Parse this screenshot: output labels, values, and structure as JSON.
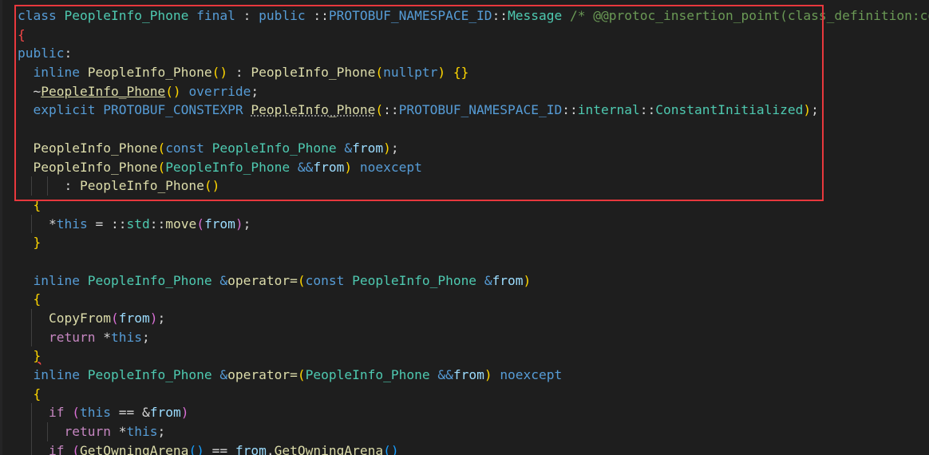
{
  "editor": {
    "theme_colors": {
      "background": "#1e1e1e",
      "keyword": "#569cd6",
      "control_keyword": "#c586c0",
      "type": "#4ec9b0",
      "function": "#dcdcaa",
      "variable": "#9cdcfe",
      "comment": "#6a9955",
      "highlight_border": "#e8383d"
    },
    "lines": [
      {
        "indent": 0,
        "guides": 0,
        "tokens": [
          {
            "t": "class ",
            "c": "kw"
          },
          {
            "t": "PeopleInfo_Phone",
            "c": "ty"
          },
          {
            "t": " ",
            "c": "p"
          },
          {
            "t": "final",
            "c": "kw"
          },
          {
            "t": " : ",
            "c": "p"
          },
          {
            "t": "public",
            "c": "kw"
          },
          {
            "t": " ::",
            "c": "p"
          },
          {
            "t": "PROTOBUF_NAMESPACE_ID",
            "c": "mac"
          },
          {
            "t": "::",
            "c": "p"
          },
          {
            "t": "Message",
            "c": "ty"
          },
          {
            "t": " /* @@protoc_insertion_point(class_definition:com",
            "c": "cm"
          }
        ]
      },
      {
        "indent": 0,
        "guides": 0,
        "tokens": [
          {
            "t": "{",
            "c": "err"
          }
        ]
      },
      {
        "indent": 0,
        "guides": 0,
        "tokens": [
          {
            "t": "public",
            "c": "kw"
          },
          {
            "t": ":",
            "c": "p"
          }
        ]
      },
      {
        "indent": 2,
        "guides": 0,
        "tokens": [
          {
            "t": "inline",
            "c": "kw"
          },
          {
            "t": " ",
            "c": "p"
          },
          {
            "t": "PeopleInfo_Phone",
            "c": "fn"
          },
          {
            "t": "()",
            "c": "br1"
          },
          {
            "t": " : ",
            "c": "p"
          },
          {
            "t": "PeopleInfo_Phone",
            "c": "fn"
          },
          {
            "t": "(",
            "c": "br1"
          },
          {
            "t": "nullptr",
            "c": "kw"
          },
          {
            "t": ")",
            "c": "br1"
          },
          {
            "t": " ",
            "c": "p"
          },
          {
            "t": "{}",
            "c": "br1"
          }
        ]
      },
      {
        "indent": 2,
        "guides": 0,
        "tokens": [
          {
            "t": "~",
            "c": "p"
          },
          {
            "t": "PeopleInfo_Phone",
            "c": "fn ul"
          },
          {
            "t": "()",
            "c": "br1"
          },
          {
            "t": " ",
            "c": "p"
          },
          {
            "t": "override",
            "c": "kw"
          },
          {
            "t": ";",
            "c": "p"
          }
        ]
      },
      {
        "indent": 2,
        "guides": 0,
        "tokens": [
          {
            "t": "explicit",
            "c": "kw"
          },
          {
            "t": " ",
            "c": "p"
          },
          {
            "t": "PROTOBUF_CONSTEXPR",
            "c": "mac"
          },
          {
            "t": " ",
            "c": "p"
          },
          {
            "t": "PeopleInfo_Phone",
            "c": "fn dots"
          },
          {
            "t": "(",
            "c": "br1"
          },
          {
            "t": "::",
            "c": "p"
          },
          {
            "t": "PROTOBUF_NAMESPACE_ID",
            "c": "mac"
          },
          {
            "t": "::",
            "c": "p"
          },
          {
            "t": "internal",
            "c": "ty"
          },
          {
            "t": "::",
            "c": "p"
          },
          {
            "t": "ConstantInitialized",
            "c": "ty"
          },
          {
            "t": ")",
            "c": "br1"
          },
          {
            "t": ";",
            "c": "p"
          }
        ]
      },
      {
        "indent": 0,
        "guides": 0,
        "tokens": []
      },
      {
        "indent": 2,
        "guides": 0,
        "tokens": [
          {
            "t": "PeopleInfo_Phone",
            "c": "fn"
          },
          {
            "t": "(",
            "c": "br1"
          },
          {
            "t": "const",
            "c": "kw"
          },
          {
            "t": " ",
            "c": "p"
          },
          {
            "t": "PeopleInfo_Phone",
            "c": "ty"
          },
          {
            "t": " ",
            "c": "p"
          },
          {
            "t": "&",
            "c": "kw"
          },
          {
            "t": "from",
            "c": "var"
          },
          {
            "t": ")",
            "c": "br1"
          },
          {
            "t": ";",
            "c": "p"
          }
        ]
      },
      {
        "indent": 2,
        "guides": 0,
        "tokens": [
          {
            "t": "PeopleInfo_Phone",
            "c": "fn"
          },
          {
            "t": "(",
            "c": "br1"
          },
          {
            "t": "PeopleInfo_Phone",
            "c": "ty"
          },
          {
            "t": " ",
            "c": "p"
          },
          {
            "t": "&&",
            "c": "kw"
          },
          {
            "t": "from",
            "c": "var"
          },
          {
            "t": ")",
            "c": "br1"
          },
          {
            "t": " ",
            "c": "p"
          },
          {
            "t": "noexcept",
            "c": "kw"
          }
        ]
      },
      {
        "indent": 6,
        "guides": 2,
        "tokens": [
          {
            "t": ": ",
            "c": "p"
          },
          {
            "t": "PeopleInfo_Phone",
            "c": "fn"
          },
          {
            "t": "()",
            "c": "br1"
          }
        ]
      },
      {
        "indent": 2,
        "guides": 0,
        "tokens": [
          {
            "t": "{",
            "c": "br1"
          }
        ]
      },
      {
        "indent": 4,
        "guides": 1,
        "tokens": [
          {
            "t": "*",
            "c": "p"
          },
          {
            "t": "this",
            "c": "kw"
          },
          {
            "t": " = ::",
            "c": "p"
          },
          {
            "t": "std",
            "c": "ty"
          },
          {
            "t": "::",
            "c": "p"
          },
          {
            "t": "move",
            "c": "fn"
          },
          {
            "t": "(",
            "c": "br2"
          },
          {
            "t": "from",
            "c": "var"
          },
          {
            "t": ")",
            "c": "br2"
          },
          {
            "t": ";",
            "c": "p"
          }
        ]
      },
      {
        "indent": 2,
        "guides": 0,
        "tokens": [
          {
            "t": "}",
            "c": "br1"
          }
        ]
      },
      {
        "indent": 0,
        "guides": 0,
        "tokens": []
      },
      {
        "indent": 2,
        "guides": 0,
        "tokens": [
          {
            "t": "inline",
            "c": "kw"
          },
          {
            "t": " ",
            "c": "p"
          },
          {
            "t": "PeopleInfo_Phone",
            "c": "ty"
          },
          {
            "t": " ",
            "c": "p"
          },
          {
            "t": "&",
            "c": "kw"
          },
          {
            "t": "operator=",
            "c": "fn"
          },
          {
            "t": "(",
            "c": "br1"
          },
          {
            "t": "const",
            "c": "kw"
          },
          {
            "t": " ",
            "c": "p"
          },
          {
            "t": "PeopleInfo_Phone",
            "c": "ty"
          },
          {
            "t": " ",
            "c": "p"
          },
          {
            "t": "&",
            "c": "kw"
          },
          {
            "t": "from",
            "c": "var"
          },
          {
            "t": ")",
            "c": "br1"
          }
        ]
      },
      {
        "indent": 2,
        "guides": 0,
        "tokens": [
          {
            "t": "{",
            "c": "br1"
          }
        ]
      },
      {
        "indent": 4,
        "guides": 1,
        "tokens": [
          {
            "t": "CopyFrom",
            "c": "fn"
          },
          {
            "t": "(",
            "c": "br2"
          },
          {
            "t": "from",
            "c": "var"
          },
          {
            "t": ")",
            "c": "br2"
          },
          {
            "t": ";",
            "c": "p"
          }
        ]
      },
      {
        "indent": 4,
        "guides": 1,
        "tokens": [
          {
            "t": "return",
            "c": "ctrl"
          },
          {
            "t": " *",
            "c": "p"
          },
          {
            "t": "this",
            "c": "kw"
          },
          {
            "t": ";",
            "c": "p"
          }
        ]
      },
      {
        "indent": 2,
        "guides": 0,
        "tokens": [
          {
            "t": "}",
            "c": "br1 squig"
          }
        ]
      },
      {
        "indent": 2,
        "guides": 0,
        "tokens": [
          {
            "t": "inline",
            "c": "kw"
          },
          {
            "t": " ",
            "c": "p"
          },
          {
            "t": "PeopleInfo_Phone",
            "c": "ty"
          },
          {
            "t": " ",
            "c": "p"
          },
          {
            "t": "&",
            "c": "kw"
          },
          {
            "t": "operator=",
            "c": "fn"
          },
          {
            "t": "(",
            "c": "br1"
          },
          {
            "t": "PeopleInfo_Phone",
            "c": "ty"
          },
          {
            "t": " ",
            "c": "p"
          },
          {
            "t": "&&",
            "c": "kw"
          },
          {
            "t": "from",
            "c": "var"
          },
          {
            "t": ")",
            "c": "br1"
          },
          {
            "t": " ",
            "c": "p"
          },
          {
            "t": "noexcept",
            "c": "kw"
          }
        ]
      },
      {
        "indent": 2,
        "guides": 0,
        "tokens": [
          {
            "t": "{",
            "c": "br1"
          }
        ]
      },
      {
        "indent": 4,
        "guides": 1,
        "tokens": [
          {
            "t": "if",
            "c": "ctrl"
          },
          {
            "t": " ",
            "c": "p"
          },
          {
            "t": "(",
            "c": "br2"
          },
          {
            "t": "this",
            "c": "kw"
          },
          {
            "t": " == &",
            "c": "p"
          },
          {
            "t": "from",
            "c": "var"
          },
          {
            "t": ")",
            "c": "br2"
          }
        ]
      },
      {
        "indent": 6,
        "guides": 2,
        "tokens": [
          {
            "t": "return",
            "c": "ctrl"
          },
          {
            "t": " *",
            "c": "p"
          },
          {
            "t": "this",
            "c": "kw"
          },
          {
            "t": ";",
            "c": "p"
          }
        ]
      },
      {
        "indent": 4,
        "guides": 1,
        "tokens": [
          {
            "t": "if",
            "c": "ctrl"
          },
          {
            "t": " ",
            "c": "p"
          },
          {
            "t": "(",
            "c": "br2"
          },
          {
            "t": "GetOwningArena",
            "c": "fn"
          },
          {
            "t": "()",
            "c": "br3"
          },
          {
            "t": " == ",
            "c": "p"
          },
          {
            "t": "from",
            "c": "var"
          },
          {
            "t": ".",
            "c": "p"
          },
          {
            "t": "GetOwningArena",
            "c": "fn"
          },
          {
            "t": "()",
            "c": "br3"
          }
        ]
      }
    ]
  }
}
